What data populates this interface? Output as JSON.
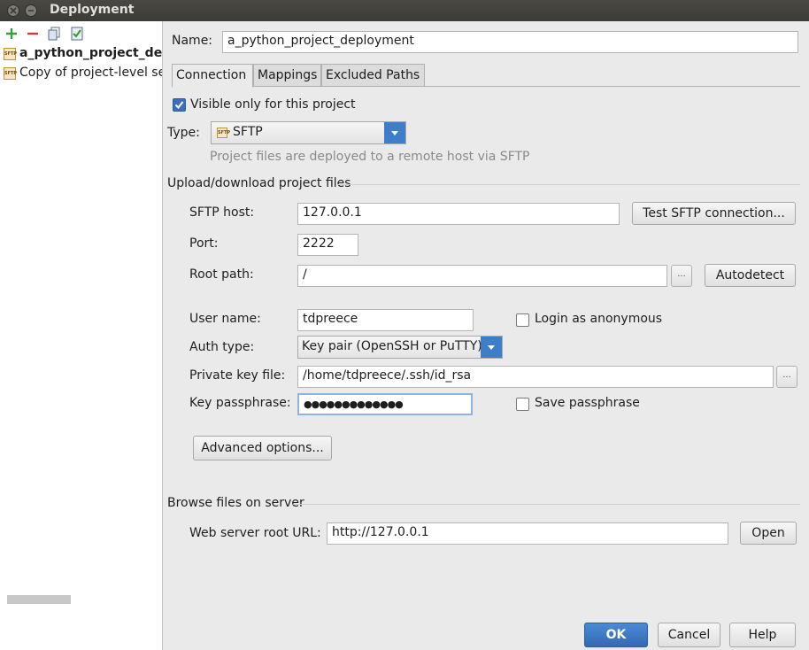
{
  "window": {
    "title": "Deployment"
  },
  "toolbar": {
    "add_icon": "plus-icon",
    "remove_icon": "minus-icon",
    "copy_icon": "copy-icon",
    "default_icon": "check-default-icon"
  },
  "tree": {
    "items": [
      {
        "label": "a_python_project_deployment",
        "icon": "sftp",
        "selected": true
      },
      {
        "label": "Copy of project-level server",
        "icon": "sftp",
        "selected": false
      }
    ]
  },
  "name": {
    "label": "Name:",
    "value": "a_python_project_deployment"
  },
  "tabs": [
    {
      "label": "Connection",
      "active": true
    },
    {
      "label": "Mappings"
    },
    {
      "label": "Excluded Paths"
    }
  ],
  "visible_only": {
    "label": "Visible only for this project",
    "checked": true
  },
  "type": {
    "label": "Type:",
    "value": "SFTP",
    "icon_text": "sftp",
    "hint": "Project files are deployed to a remote host via SFTP"
  },
  "upload_section": {
    "title": "Upload/download project files"
  },
  "sftp_host": {
    "label": "SFTP host:",
    "value": "127.0.0.1",
    "test_button": "Test SFTP connection..."
  },
  "port": {
    "label": "Port:",
    "value": "2222"
  },
  "root_path": {
    "label": "Root path:",
    "value": "/",
    "browse": "...",
    "autodetect": "Autodetect"
  },
  "user_name": {
    "label": "User name:",
    "value": "tdpreece",
    "anonymous_label": "Login as anonymous",
    "anonymous_checked": false
  },
  "auth_type": {
    "label": "Auth type:",
    "value": "Key pair (OpenSSH or PuTTY)"
  },
  "private_key": {
    "label": "Private key file:",
    "value": "/home/tdpreece/.ssh/id_rsa",
    "browse": "..."
  },
  "passphrase": {
    "label": "Key passphrase:",
    "value": "●●●●●●●●●●●●●",
    "save_label": "Save passphrase",
    "save_checked": false
  },
  "advanced_button": "Advanced options...",
  "browse_section": {
    "title": "Browse files on server"
  },
  "web_root": {
    "label": "Web server root URL:",
    "value": "http://127.0.0.1",
    "open": "Open"
  },
  "footer": {
    "ok": "OK",
    "cancel": "Cancel",
    "help": "Help"
  },
  "colors": {
    "accent": "#3e7ec9",
    "ok_button": "#3b78c9",
    "titlebar": "#3c3b37"
  }
}
